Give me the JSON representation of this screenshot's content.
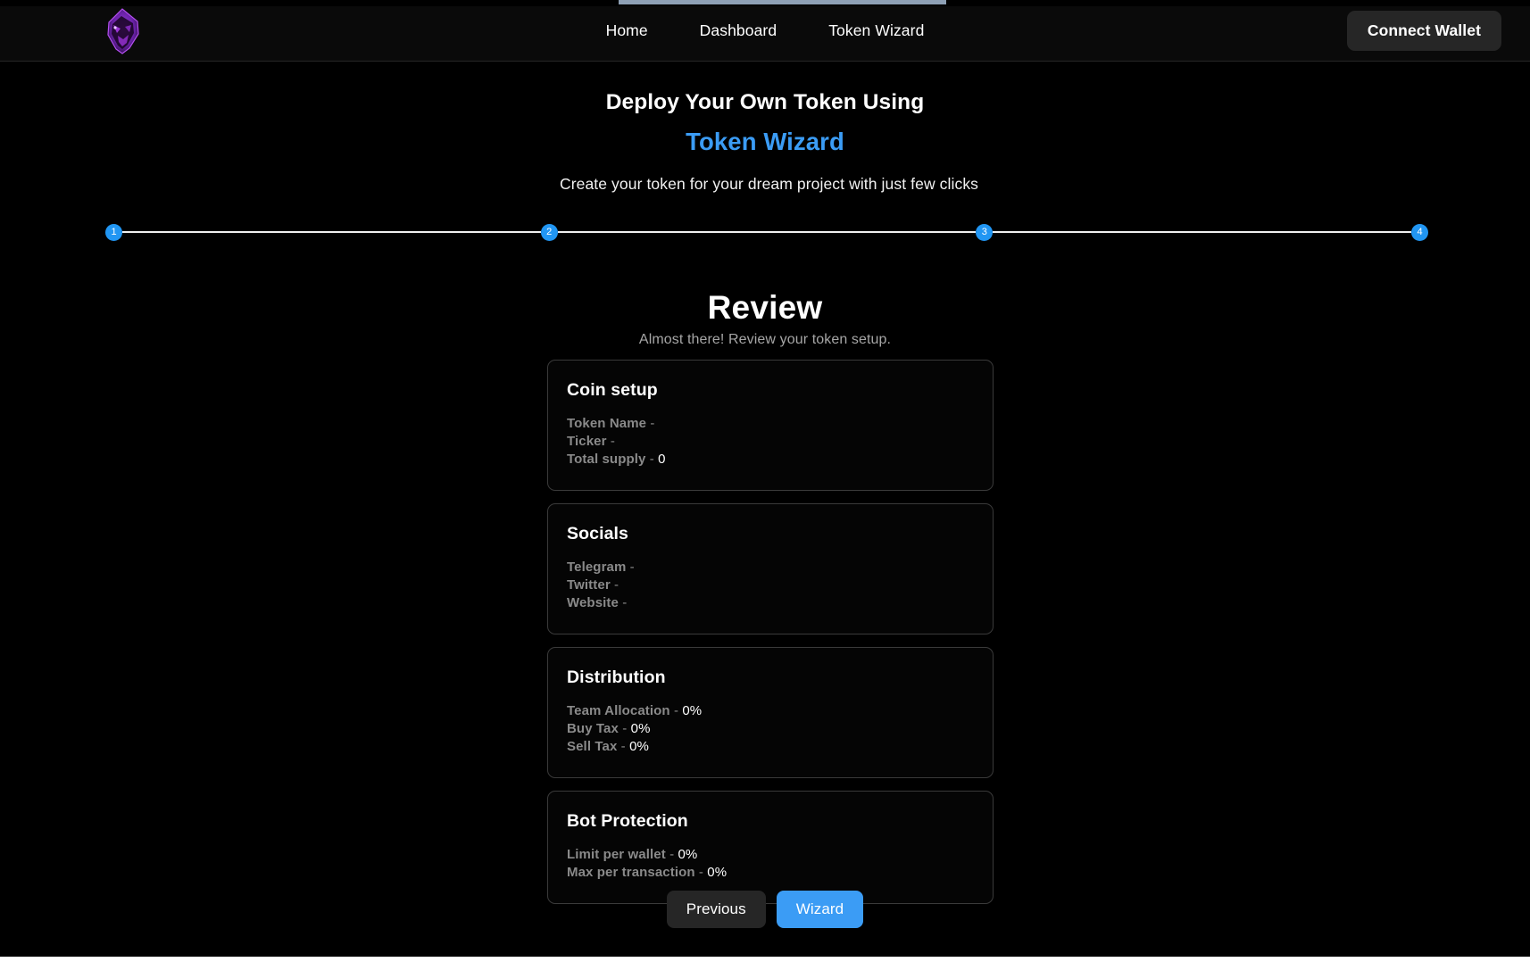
{
  "navbar": {
    "logo_icon": "wolf-head-logo-icon",
    "logo_color": "#7b2fbe",
    "links": [
      {
        "label": "Home"
      },
      {
        "label": "Dashboard"
      },
      {
        "label": "Token Wizard"
      }
    ],
    "connect_wallet_label": "Connect Wallet"
  },
  "hero": {
    "title_line1": "Deploy Your Own Token Using",
    "title_line2": "Token Wizard",
    "title_line2_color": "#3b9cf5",
    "subtitle": "Create your token for your dream project with just few clicks"
  },
  "stepper": {
    "active_color": "#2196f3",
    "line_color": "#f0f0f0",
    "steps": [
      {
        "number": "1"
      },
      {
        "number": "2"
      },
      {
        "number": "3"
      },
      {
        "number": "4"
      }
    ]
  },
  "review": {
    "heading": "Review",
    "subheading": "Almost there! Review your token setup.",
    "cards": [
      {
        "title": "Coin setup",
        "rows": [
          {
            "label": "Token Name",
            "sep": "-",
            "value": ""
          },
          {
            "label": "Ticker",
            "sep": "-",
            "value": ""
          },
          {
            "label": "Total supply",
            "sep": "-",
            "value": "0"
          }
        ]
      },
      {
        "title": "Socials",
        "rows": [
          {
            "label": "Telegram",
            "sep": "-",
            "value": ""
          },
          {
            "label": "Twitter",
            "sep": "-",
            "value": ""
          },
          {
            "label": "Website",
            "sep": "-",
            "value": ""
          }
        ]
      },
      {
        "title": "Distribution",
        "rows": [
          {
            "label": "Team Allocation",
            "sep": "-",
            "value": "0%"
          },
          {
            "label": "Buy Tax",
            "sep": "-",
            "value": "0%"
          },
          {
            "label": "Sell Tax",
            "sep": "-",
            "value": "0%"
          }
        ]
      },
      {
        "title": "Bot Protection",
        "rows": [
          {
            "label": "Limit per wallet",
            "sep": "-",
            "value": "0%"
          },
          {
            "label": "Max per transaction",
            "sep": "-",
            "value": "0%"
          }
        ]
      }
    ]
  },
  "actions": {
    "previous_label": "Previous",
    "wizard_label": "Wizard",
    "wizard_color": "#3b9cf5"
  }
}
